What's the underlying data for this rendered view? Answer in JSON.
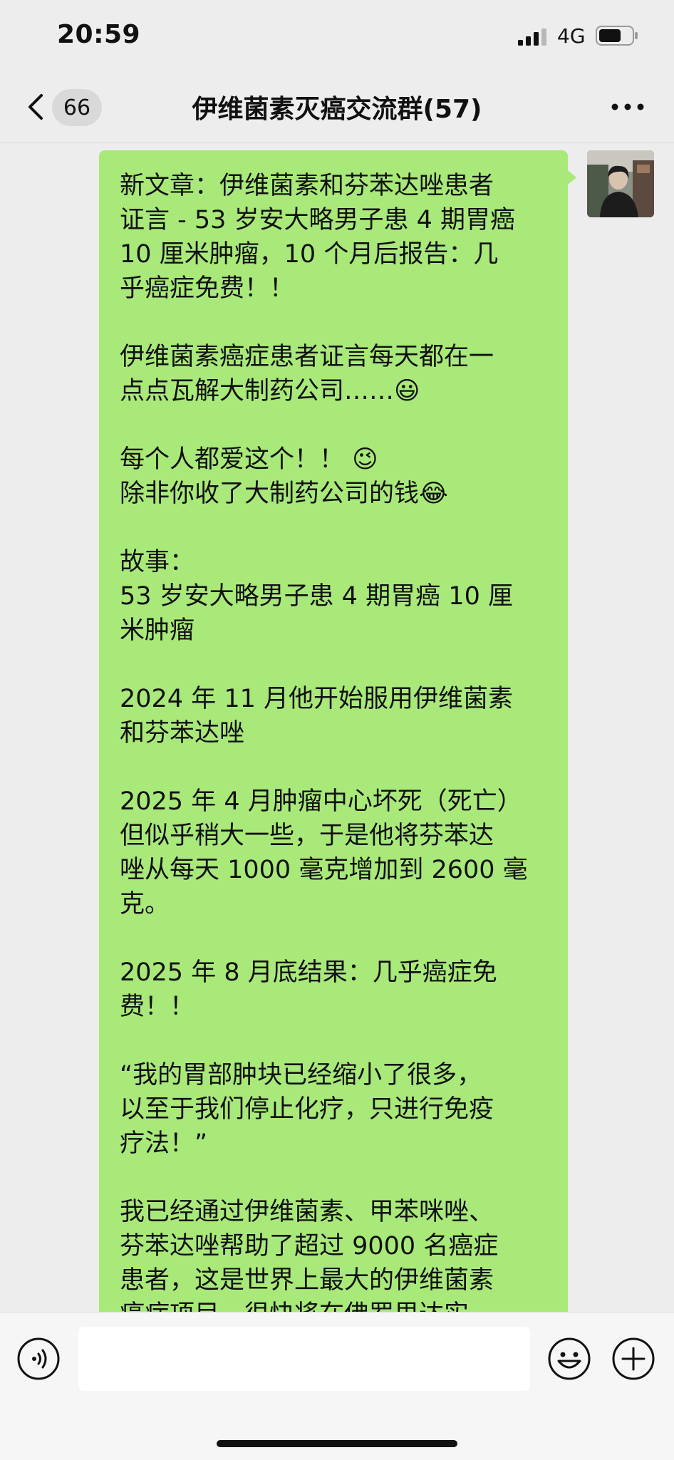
{
  "status_bar": {
    "time": "20:59",
    "network": "4G"
  },
  "nav": {
    "unread_count": "66",
    "title": "伊维菌素灭癌交流群(57)"
  },
  "message": {
    "sender": "self",
    "paragraphs": [
      [
        "新文章：伊维菌素和芬苯达唑患者",
        "证言 - 53 岁安大略男子患 4 期胃癌",
        "10 厘米肿瘤，10 个月后报告：几",
        "乎癌症免费！！"
      ],
      [
        "伊维菌素癌症患者证言每天都在一",
        "点点瓦解大制药公司……😃"
      ],
      [
        "每个人都爱这个！！ 😉",
        "除非你收了大制药公司的钱😂"
      ],
      [
        "故事：",
        "53 岁安大略男子患 4 期胃癌 10 厘",
        "米肿瘤"
      ],
      [
        "2024 年 11 月他开始服用伊维菌素",
        "和芬苯达唑"
      ],
      [
        "2025 年 4 月肿瘤中心坏死（死亡）",
        "但似乎稍大一些，于是他将芬苯达",
        "唑从每天 1000 毫克增加到 2600 毫",
        "克。"
      ],
      [
        "2025 年 8 月底结果：几乎癌症免",
        "费！！"
      ],
      [
        "“我的胃部肿块已经缩小了很多，",
        "以至于我们停止化疗，只进行免疫",
        "疗法！”"
      ],
      [
        "我已经通过伊维菌素、甲苯咪唑、",
        "芬苯达唑帮助了超过 9000 名癌症",
        "患者，这是世界上最大的伊维菌素",
        "癌症项目。很快将在佛罗里达实..."
      ]
    ]
  },
  "input": {
    "value": "",
    "placeholder": ""
  },
  "colors": {
    "background": "#ededed",
    "bubble_self": "#a9e97a",
    "input_bar": "#f6f6f6"
  },
  "icons": [
    "signal-icon",
    "battery-icon",
    "back-icon",
    "more-icon",
    "voice-icon",
    "emoji-icon",
    "plus-icon"
  ]
}
